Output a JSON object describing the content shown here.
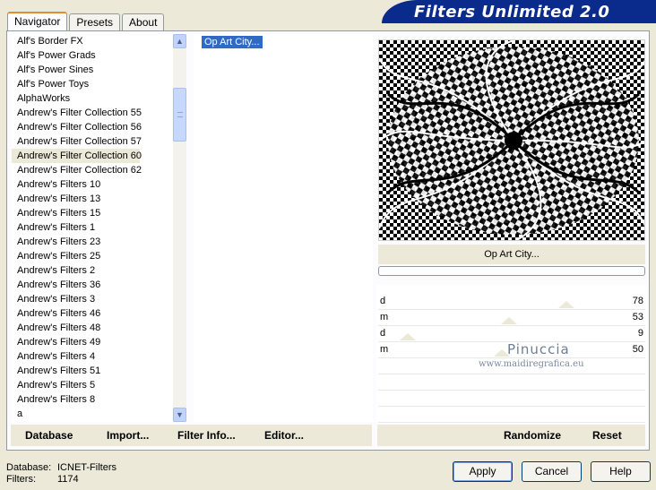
{
  "app": {
    "title": "Filters Unlimited 2.0"
  },
  "tabs": [
    {
      "label": "Navigator"
    },
    {
      "label": "Presets"
    },
    {
      "label": "About"
    }
  ],
  "categories": [
    "Alf's Border FX",
    "Alf's Power Grads",
    "Alf's Power Sines",
    "Alf's Power Toys",
    "AlphaWorks",
    "Andrew's Filter Collection 55",
    "Andrew's Filter Collection 56",
    "Andrew's Filter Collection 57",
    "Andrew's Filter Collection 60",
    "Andrew's Filter Collection 62",
    "Andrew's Filters 10",
    "Andrew's Filters 13",
    "Andrew's Filters 15",
    "Andrew's Filters 1",
    "Andrew's Filters 23",
    "Andrew's Filters 25",
    "Andrew's Filters 2",
    "Andrew's Filters 36",
    "Andrew's Filters 3",
    "Andrew's Filters 46",
    "Andrew's Filters 48",
    "Andrew's Filters 49",
    "Andrew's Filters 4",
    "Andrew's Filters 51",
    "Andrew's Filters 5",
    "Andrew's Filters 8",
    "a"
  ],
  "selected_category_index": 8,
  "filters": [
    "Op Art City..."
  ],
  "preview": {
    "filter_name": "Op Art City..."
  },
  "params": [
    {
      "label": "d",
      "value": "78",
      "level": 78
    },
    {
      "label": "m",
      "value": "53",
      "level": 53
    },
    {
      "label": "d",
      "value": "9",
      "level": 9
    },
    {
      "label": "m",
      "value": "50",
      "level": 50
    }
  ],
  "watermark": {
    "name": "Pinuccia",
    "site": "www.maidiregrafica.eu"
  },
  "left_actions": {
    "database": "Database",
    "import": "Import...",
    "filter_info": "Filter Info...",
    "editor": "Editor..."
  },
  "right_actions": {
    "randomize": "Randomize",
    "reset": "Reset"
  },
  "status": {
    "database_label": "Database:",
    "database_value": "ICNET-Filters",
    "filters_label": "Filters:",
    "filters_value": "1174"
  },
  "buttons": {
    "apply": "Apply",
    "cancel": "Cancel",
    "help": "Help"
  },
  "colors": {
    "banner": "#0a2a8c",
    "selection": "#316ac5",
    "tab_accent": "#e68b2c"
  }
}
